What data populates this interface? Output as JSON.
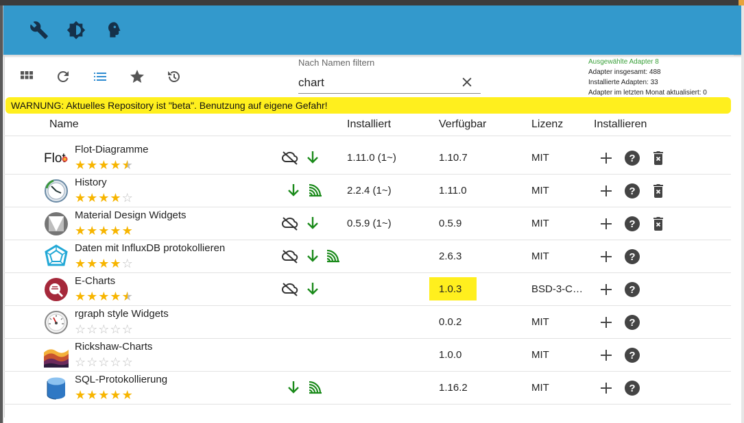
{
  "toolbar": {
    "filter_label": "Nach Namen filtern",
    "filter_value": "chart"
  },
  "stats": {
    "selected": "Ausgewählte Adapter 8",
    "total": "Adapter insgesamt: 488",
    "installed": "Installierte Adapten: 33",
    "updated": "Adapter im letzten Monat aktualisiert: 0"
  },
  "warning": "WARNUNG: Aktuelles Repository ist \"beta\". Benutzung auf eigene Gefahr!",
  "columns": {
    "name": "Name",
    "installed": "Installiert",
    "available": "Verfügbar",
    "license": "Lizenz",
    "install": "Installieren"
  },
  "colors": {
    "appbar": "#3399cc",
    "star": "#f7b500",
    "status_green": "#1a8a1a",
    "warning": "#ffef1e"
  },
  "rows": [
    {
      "name": "Flot-Diagramme",
      "logo_text": "Flot",
      "rating": 4.5,
      "installed": "1.11.0 (1~)",
      "available": "1.10.7",
      "license": "MIT"
    },
    {
      "name": "History",
      "rating": 4,
      "installed": "2.2.4 (1~)",
      "available": "1.11.0",
      "license": "MIT"
    },
    {
      "name": "Material Design Widgets",
      "rating": 5,
      "installed": "0.5.9 (1~)",
      "available": "0.5.9",
      "license": "MIT"
    },
    {
      "name": "Daten mit InfluxDB protokollieren",
      "rating": 4,
      "installed": "",
      "available": "2.6.3",
      "license": "MIT"
    },
    {
      "name": "E-Charts",
      "rating": 4.5,
      "installed": "",
      "available": "1.0.3",
      "license": "BSD-3-C…"
    },
    {
      "name": "rgraph style Widgets",
      "rating": 0,
      "installed": "",
      "available": "0.0.2",
      "license": "MIT"
    },
    {
      "name": "Rickshaw-Charts",
      "rating": 0,
      "installed": "",
      "available": "1.0.0",
      "license": "MIT"
    },
    {
      "name": "SQL-Protokollierung",
      "rating": 5,
      "installed": "",
      "available": "1.16.2",
      "license": "MIT"
    }
  ]
}
